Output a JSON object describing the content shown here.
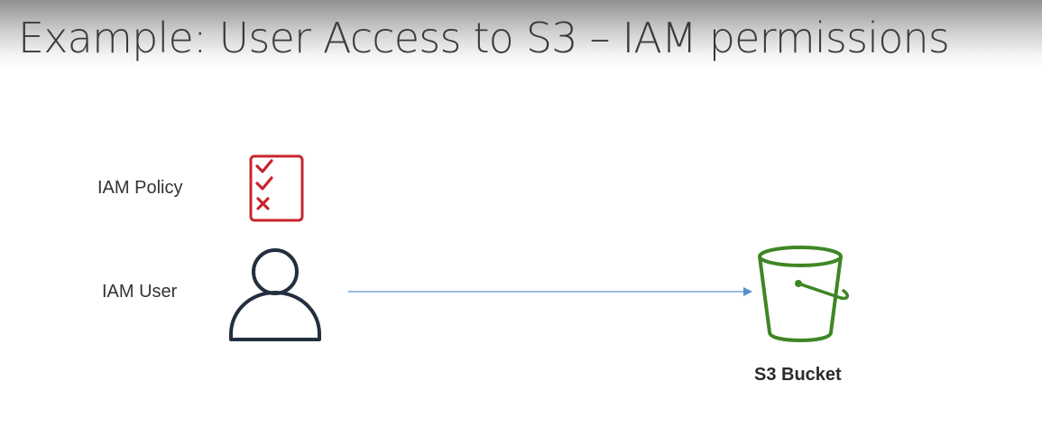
{
  "title": "Example: User Access to S3 – IAM permissions",
  "labels": {
    "policy": "IAM Policy",
    "user": "IAM User",
    "bucket": "S3 Bucket"
  },
  "icons": {
    "policy": "policy-checklist-icon",
    "user": "user-icon",
    "bucket": "s3-bucket-icon"
  },
  "colors": {
    "policy": "#c7262d",
    "user": "#232f3e",
    "bucket": "#3f8624",
    "arrow": "#5b8fc9",
    "title": "#3a3a3a"
  }
}
